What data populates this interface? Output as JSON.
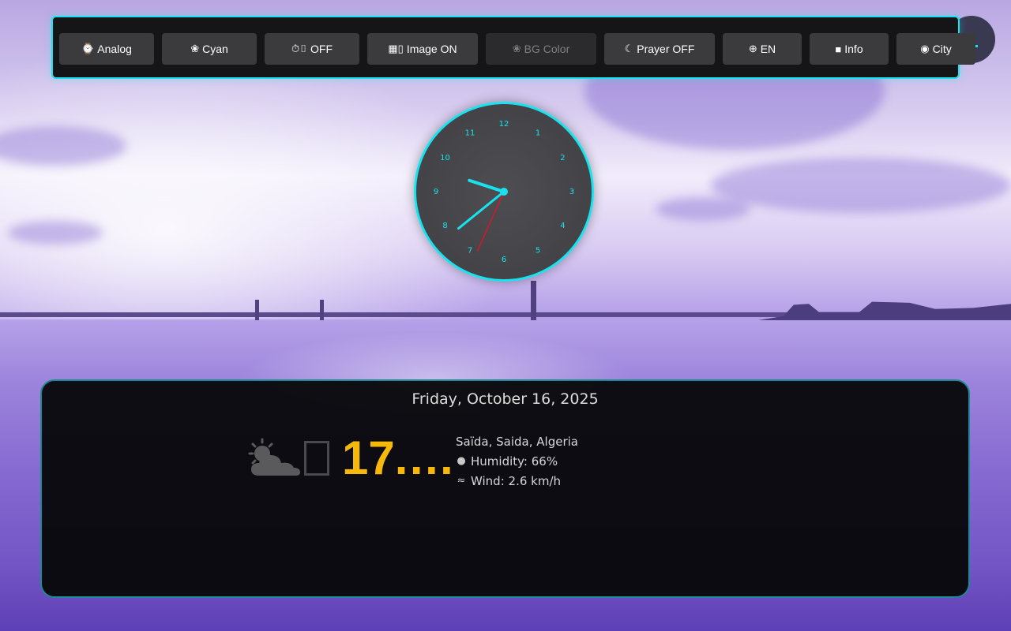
{
  "toolbar": {
    "buttons": [
      {
        "icon": "clock-icon",
        "glyph": "⌚",
        "label": "Analog"
      },
      {
        "icon": "palette-icon",
        "glyph": "❀",
        "label": "Cyan"
      },
      {
        "icon": "timer-icon",
        "glyph": "⏱▯",
        "label": "OFF"
      },
      {
        "icon": "picture-icon",
        "glyph": "▦▯",
        "label": "Image ON"
      },
      {
        "icon": "palette-icon",
        "glyph": "❀",
        "label": "BG Color"
      },
      {
        "icon": "moon-icon",
        "glyph": "☾",
        "label": "Prayer OFF"
      },
      {
        "icon": "globe-icon",
        "glyph": "⊕",
        "label": "EN"
      },
      {
        "icon": "clipboard-icon",
        "glyph": "■",
        "label": "Info"
      },
      {
        "icon": "globe-icon",
        "glyph": "◉",
        "label": "City"
      }
    ]
  },
  "clock": {
    "numerals": [
      "12",
      "1",
      "2",
      "3",
      "4",
      "5",
      "6",
      "7",
      "8",
      "9",
      "10",
      "11"
    ],
    "hour": 9.6,
    "minute": 38.5,
    "second": 34,
    "accent": "#17e3ef",
    "second_color": "#d11a2a"
  },
  "weather": {
    "date": "Friday, October 16, 2025",
    "temperature": "17.….",
    "location": "Saïda, Saida, Algeria",
    "humidity": "Humidity: 66%",
    "wind": "Wind: 2.6 km/h",
    "temp_color": "#f6b90a"
  },
  "colors": {
    "accent": "#17e3ef",
    "panel_border": "#1a8b96"
  }
}
